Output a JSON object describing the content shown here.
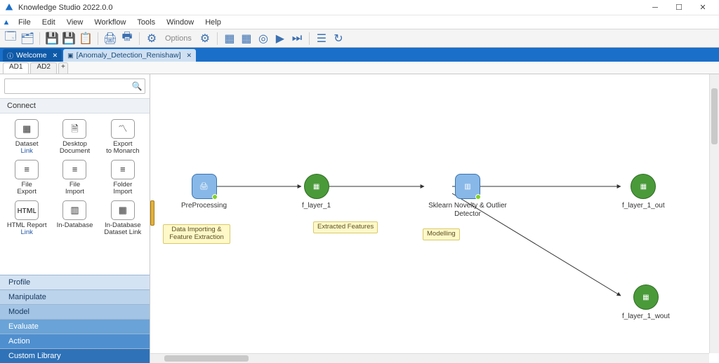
{
  "app": {
    "title": "Knowledge Studio 2022.0.0"
  },
  "menus": {
    "file": "File",
    "edit": "Edit",
    "view": "View",
    "workflow": "Workflow",
    "tools": "Tools",
    "window": "Window",
    "help": "Help"
  },
  "toolbar": {
    "options": "Options"
  },
  "tabs": {
    "welcome": "Welcome",
    "doc": "[Anomaly_Detection_Renishaw]"
  },
  "subtabs": {
    "ad1": "AD1",
    "ad2": "AD2"
  },
  "search": {
    "placeholder": ""
  },
  "panels": {
    "connect": "Connect",
    "categories": [
      "Profile",
      "Manipulate",
      "Model",
      "Evaluate",
      "Action",
      "Custom Library"
    ]
  },
  "nodes": [
    {
      "t": "Dataset",
      "s": "Link"
    },
    {
      "t": "Desktop",
      "s": "Document"
    },
    {
      "t": "Export",
      "s": "to Monarch"
    },
    {
      "t": "File",
      "s": "Export"
    },
    {
      "t": "File",
      "s": "Import"
    },
    {
      "t": "Folder",
      "s": "Import"
    },
    {
      "t": "HTML Report",
      "s": "Link"
    },
    {
      "t": "In-Database",
      "s": ""
    },
    {
      "t": "In-Database",
      "s": "Dataset Link"
    }
  ],
  "flow": {
    "pre": {
      "label": "PreProcessing"
    },
    "l1": {
      "label": "f_layer_1"
    },
    "det": {
      "label": "Sklearn Novelty & Outlier Detector"
    },
    "out": {
      "label": "f_layer_1_out"
    },
    "wout": {
      "label": "f_layer_1_wout"
    },
    "notes": {
      "n1": "Data Importing & Feature Extraction",
      "n2": "Extracted Features",
      "n3": "Modelling"
    }
  }
}
